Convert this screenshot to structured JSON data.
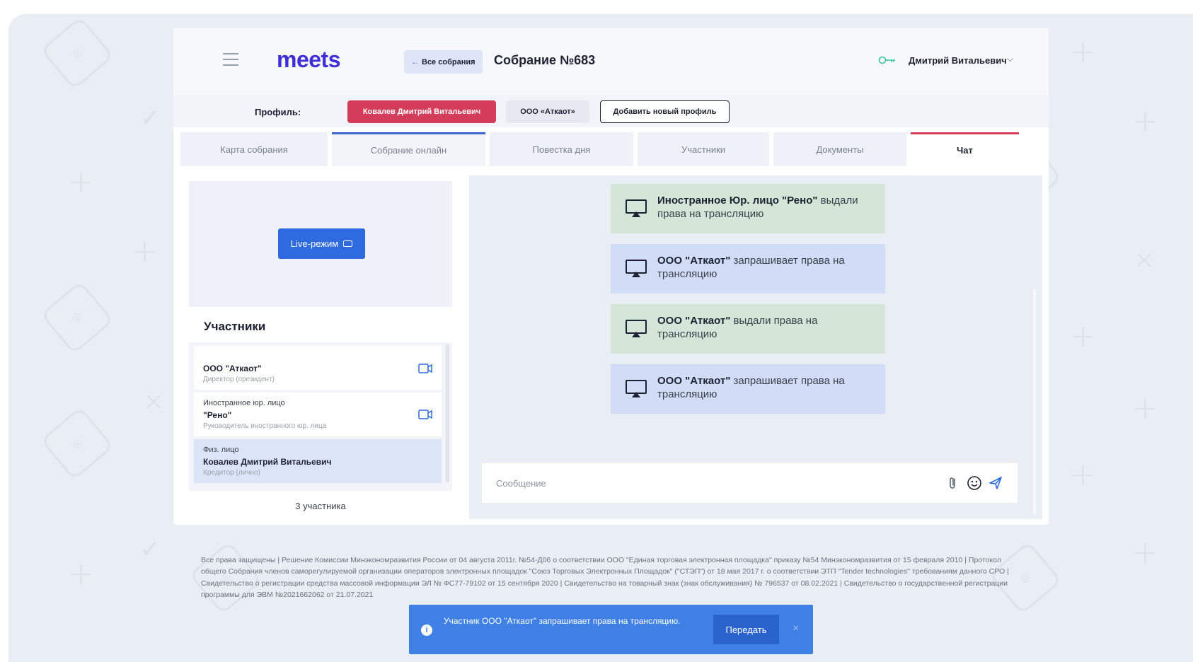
{
  "app": {
    "logo": "meets",
    "back_label": "Все собрания",
    "meeting_title": "Собрание №683",
    "user_name": "Дмитрий Витальевич"
  },
  "profile": {
    "label": "Профиль:",
    "active": "Ковалев Дмитрий Витальевич",
    "org": "ООО «Аткаот»",
    "add_label": "Добавить новый профиль"
  },
  "tabs": [
    {
      "label": "Карта собрания"
    },
    {
      "label": "Собрание онлайн"
    },
    {
      "label": "Повестка дня"
    },
    {
      "label": "Участники"
    },
    {
      "label": "Документы"
    },
    {
      "label": "Чат"
    }
  ],
  "left": {
    "live_label": "Live-режим",
    "participants_title": "Участники",
    "participants": [
      {
        "type": "",
        "name": "ООО \"Аткаот\"",
        "role": "Директор (президент)",
        "video": "camera-icon"
      },
      {
        "type": "Иностранное юр. лицо",
        "name": "\"Рено\"",
        "role": "Руководитель иностранного юр. лица",
        "video": "camera-icon"
      },
      {
        "type": "Физ. лицо",
        "name": "Ковалев Дмитрий Витальевич",
        "role": "Кредитор (лично)"
      }
    ],
    "count": "3 участника"
  },
  "chat": {
    "messages": [
      {
        "color": "green",
        "bold": "Иностранное Юр. лицо \"Рено\"",
        "text": " выдали права на трансляцию",
        "icon": "broadcast-icon"
      },
      {
        "color": "blue",
        "bold": "ООО \"Аткаот\"",
        "text": " запрашивает права на трансляцию",
        "icon": "broadcast-icon"
      },
      {
        "color": "green",
        "bold": "ООО \"Аткаот\"",
        "text": " выдали права на трансляцию",
        "icon": "broadcast-icon"
      },
      {
        "color": "blue",
        "bold": "ООО \"Аткаот\"",
        "text": " запрашивает права на трансляцию",
        "icon": "broadcast-icon"
      }
    ],
    "input_placeholder": "Сообщение",
    "input_value": ""
  },
  "footer": {
    "text": "Все права защищены | Решение Комиссии Минэкономразвития России от 04 августа 2011г. №54-Д06 о соответствии ООО \"Единая торговая электронная площадка\" приказу №54 Минэкономразвития от 15 февраля 2010 | Протокол общего Собрания членов саморегулируемой организации операторов электронных площадок \"Союз Торговых Электронных Площадок\" (\"СТЭП\") от 18 мая 2017 г. о соответствии ЭТП \"Tender technologies\" требованиям данного СРО | Свидетельство о регистрации средства массовой информации ЭЛ № ФС77-79102 от 15 сентября 2020 | Свидетельство на товарный знак (знак обслуживания) № 796537 от 08.02.2021 | Свидетельство о государственной регистрации программы для ЭВМ №2021662062 от 21.07.2021"
  },
  "toast": {
    "text": "Участник ООО \"Аткаот\" запрашивает права на трансляцию.",
    "button": "Передать",
    "close": "×"
  },
  "colors": {
    "brand": "#3f2fd6",
    "accent_red": "#d43d5a",
    "primary_blue": "#2f6be0",
    "msg_green": "#d3e6d7",
    "msg_blue": "#d1dcf7",
    "toast_blue": "#3f80e6"
  }
}
